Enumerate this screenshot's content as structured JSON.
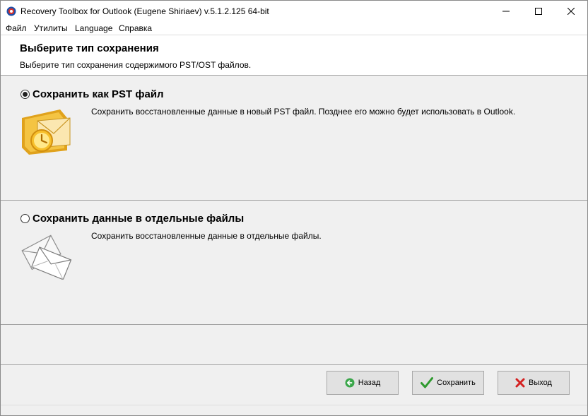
{
  "window": {
    "title": "Recovery Toolbox for Outlook (Eugene Shiriaev) v.5.1.2.125 64-bit",
    "controls": {
      "minimize": "—",
      "maximize": "☐",
      "close": "✕"
    }
  },
  "menu": {
    "items": [
      {
        "label": "Файл"
      },
      {
        "label": "Утилиты"
      },
      {
        "label": "Language"
      },
      {
        "label": "Справка"
      }
    ]
  },
  "header": {
    "title": "Выберите тип сохранения",
    "subtitle": "Выберите тип сохранения содержимого PST/OST файлов."
  },
  "options": [
    {
      "label": "Сохранить как PST файл",
      "description": "Сохранить восстановленные данные в новый PST файл. Позднее его можно будет использовать в Outlook.",
      "selected": true,
      "icon": "outlook-pst-icon"
    },
    {
      "label": "Сохранить данные в отдельные файлы",
      "description": "Сохранить восстановленные данные в отдельные файлы.",
      "selected": false,
      "icon": "envelopes-icon"
    }
  ],
  "buttons": {
    "back": {
      "label": "Назад",
      "icon": "back-arrow-icon",
      "color": "#3aa64a"
    },
    "save": {
      "label": "Сохранить",
      "icon": "checkmark-icon",
      "color": "#2e9a2e"
    },
    "exit": {
      "label": "Выход",
      "icon": "x-mark-icon",
      "color": "#d42020"
    }
  }
}
